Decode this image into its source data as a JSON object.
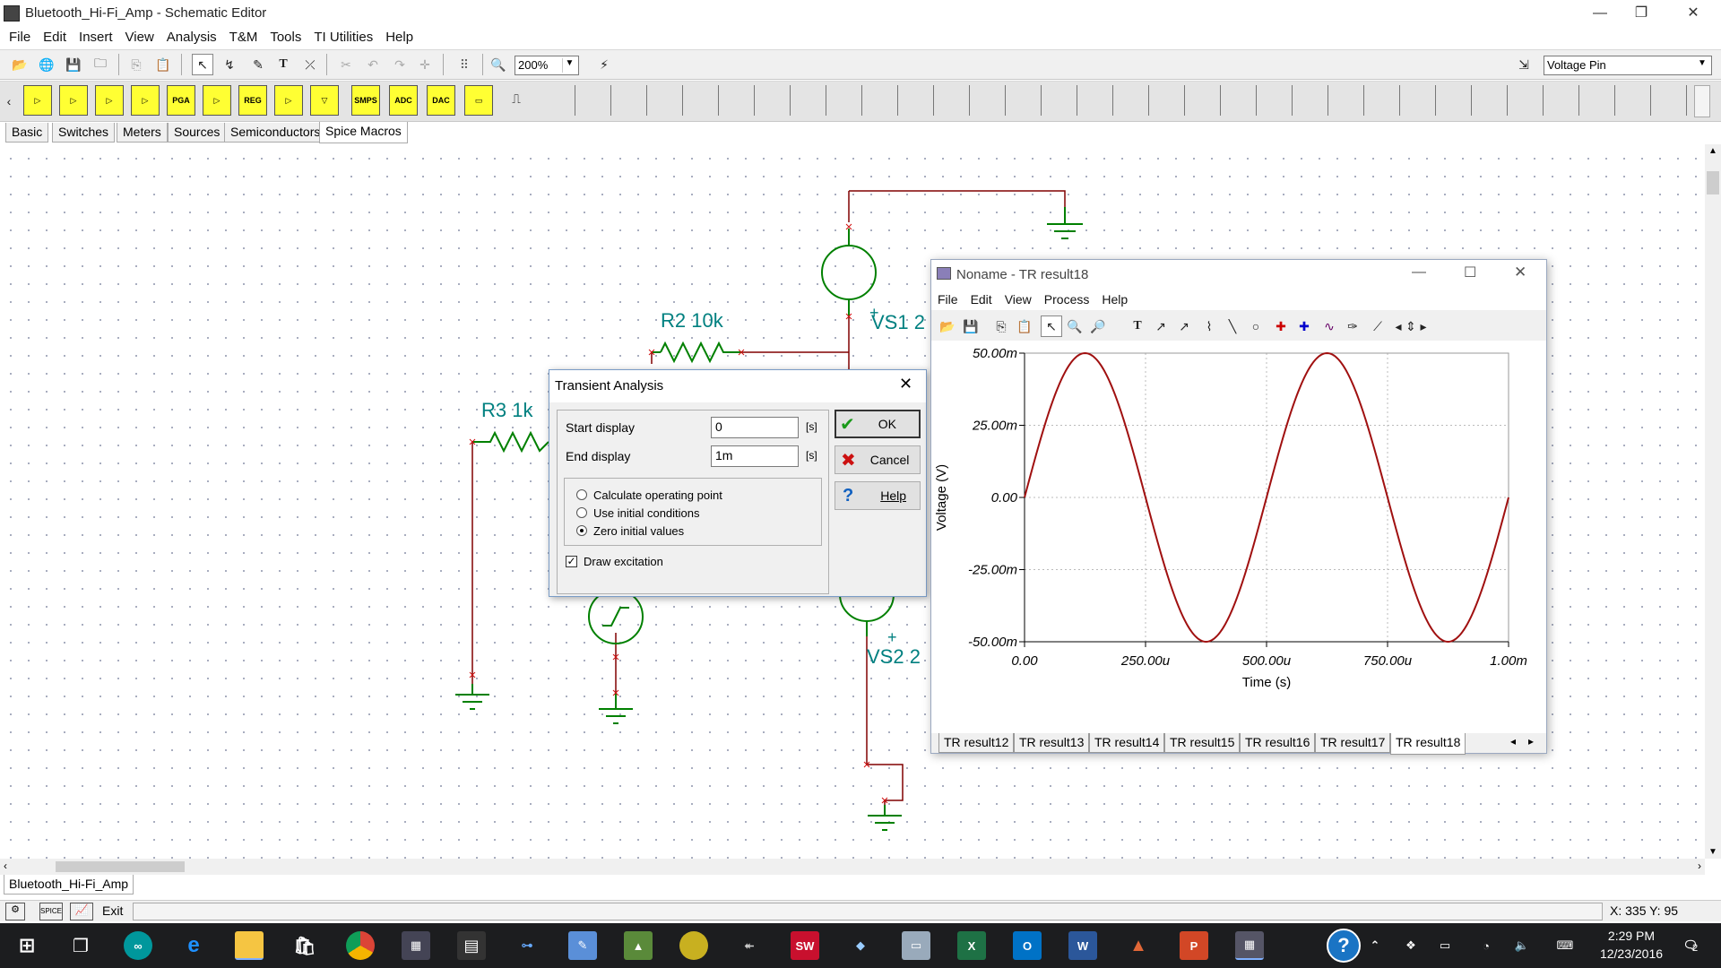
{
  "window": {
    "title": "Bluetooth_Hi-Fi_Amp - Schematic Editor"
  },
  "menu": [
    "File",
    "Edit",
    "Insert",
    "View",
    "Analysis",
    "T&M",
    "Tools",
    "TI Utilities",
    "Help"
  ],
  "toolbar": {
    "zoom": "200%",
    "pin_type": "Voltage Pin"
  },
  "component_bar": {
    "labels": [
      "PGA",
      "REG",
      "SMPS",
      "ADC",
      "DAC"
    ]
  },
  "component_tabs": [
    "Basic",
    "Switches",
    "Meters",
    "Sources",
    "Semiconductors",
    "Spice Macros"
  ],
  "schematic": {
    "labels": {
      "r2": "R2 10k",
      "r3": "R3 1k",
      "vs1": "VS1 2",
      "vs2": "VS2 2",
      "plus": "+"
    }
  },
  "dialog": {
    "title": "Transient Analysis",
    "start_label": "Start display",
    "start_value": "0",
    "end_label": "End display",
    "end_value": "1m",
    "unit": "[s]",
    "options": [
      "Calculate operating point",
      "Use initial conditions",
      "Zero initial values"
    ],
    "selected_option": 2,
    "draw_excitation_label": "Draw excitation",
    "draw_excitation_checked": true,
    "ok": "OK",
    "cancel": "Cancel",
    "help": "Help"
  },
  "result_window": {
    "title": "Noname - TR result18",
    "menu": [
      "File",
      "Edit",
      "View",
      "Process",
      "Help"
    ],
    "tabs": [
      "TR result12",
      "TR result13",
      "TR result14",
      "TR result15",
      "TR result16",
      "TR result17",
      "TR result18"
    ],
    "active_tab": 6
  },
  "chart_data": {
    "type": "line",
    "xlabel": "Time (s)",
    "ylabel": "Voltage (V)",
    "xlim": [
      0,
      0.001
    ],
    "ylim": [
      -0.05,
      0.05
    ],
    "x_ticks": [
      "0.00",
      "250.00u",
      "500.00u",
      "750.00u",
      "1.00m"
    ],
    "y_ticks": [
      "50.00m",
      "25.00m",
      "0.00",
      "-25.00m",
      "-50.00m"
    ],
    "grid": true,
    "series": [
      {
        "color": "#a01010",
        "amplitude": 0.05,
        "frequency_hz": 2000,
        "x": [
          0,
          0.000125,
          0.00025,
          0.000375,
          0.0005,
          0.000625,
          0.00075,
          0.000875,
          0.001
        ],
        "y": [
          0,
          0.05,
          0,
          -0.05,
          0,
          0.05,
          0,
          -0.05,
          0
        ]
      }
    ]
  },
  "document_tab": "Bluetooth_Hi-Fi_Amp",
  "status": {
    "exit": "Exit",
    "coords": "X: 335 Y: 95"
  },
  "taskbar": {
    "time": "2:29 PM",
    "date": "12/23/2016",
    "notifications": "2"
  }
}
